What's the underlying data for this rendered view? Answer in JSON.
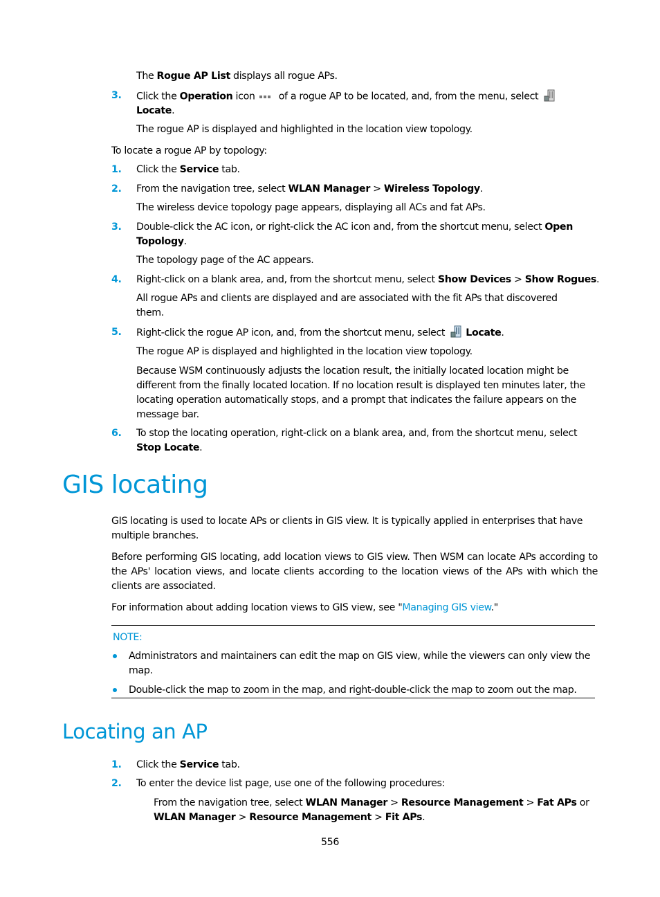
{
  "intro_line": {
    "pre": "The ",
    "bold": "Rogue AP List",
    "post": " displays all rogue APs."
  },
  "step_a3": {
    "num": "3.",
    "pre": "Click the ",
    "bold1": "Operation",
    "mid1": " icon",
    "icon": "operation-dots-icon",
    "mid2": " of a rogue AP to be located, and, from the menu, select",
    "icon2": "locate-building-icon",
    "bold2": "Locate",
    "post": ".",
    "result": "The rogue AP is displayed and highlighted in the location view topology."
  },
  "topology_intro": "To locate a rogue AP by topology:",
  "topology_steps": [
    {
      "num": "1.",
      "pre": "Click the ",
      "bold": "Service",
      "post": " tab."
    },
    {
      "num": "2.",
      "pre": "From the navigation tree, select ",
      "bold1": "WLAN Manager",
      "sep": " > ",
      "bold2": "Wireless Topology",
      "post": ".",
      "result": "The wireless device topology page appears, displaying all ACs and fat APs."
    },
    {
      "num": "3.",
      "line1_pre": "Double-click the AC icon, or right-click the AC icon and, from the shortcut menu, select ",
      "line1_bold": "Open",
      "line2_bold": "Topology",
      "line2_post": ".",
      "result": "The topology page of the AC appears."
    },
    {
      "num": "4.",
      "pre": "Right-click on a blank area, and, from the shortcut menu, select ",
      "bold1": "Show Devices",
      "sep": " > ",
      "bold2": "Show Rogues",
      "post": ".",
      "result_line1": "All rogue APs and clients are displayed and are associated with the fit APs that discovered",
      "result_line2": "them."
    },
    {
      "num": "5.",
      "pre": "Right-click the rogue AP icon, and, from the shortcut menu, select",
      "icon": "locate-building-icon",
      "bold": "Locate",
      "post": ".",
      "result": "The rogue AP is displayed and highlighted in the location view topology.",
      "note_lines": [
        "Because WSM continuously adjusts the location result, the initially located location might be",
        "different from the finally located location. If no location result is displayed ten minutes later, the",
        "locating operation automatically stops, and a prompt that indicates the failure appears on the",
        "message bar."
      ]
    },
    {
      "num": "6.",
      "line1": "To stop the locating operation, right-click on a blank area, and, from the shortcut menu, select",
      "line2_bold": "Stop Locate",
      "line2_post": "."
    }
  ],
  "gis_section": {
    "title": "GIS locating",
    "para1": "GIS locating is used to locate APs or clients in GIS view. It is typically applied in enterprises that have multiple branches.",
    "para2": "Before performing GIS locating, add location views to GIS view. Then WSM can locate APs according to the APs' location views, and locate clients according to the location views of the APs with which the clients are associated.",
    "para3_pre": "For information about adding location views to GIS view, see \"",
    "para3_link": "Managing GIS view",
    "para3_post": ".\"",
    "note_label": "NOTE:",
    "note_bullets": [
      "Administrators and maintainers can edit the map on GIS view, while the viewers can only view the map.",
      "Double-click the map to zoom in the map, and right-double-click the map to zoom out the map."
    ]
  },
  "ap_section": {
    "title": "Locating an AP",
    "steps": [
      {
        "num": "1.",
        "pre": "Click the ",
        "bold": "Service",
        "post": " tab."
      },
      {
        "num": "2.",
        "text": "To enter the device list page, use one of the following procedures:"
      }
    ],
    "sub_line1": {
      "pre": "From the navigation tree, select ",
      "b1": "WLAN Manager",
      "s1": " > ",
      "b2": "Resource Management",
      "s2": " > ",
      "b3": "Fat APs",
      "post": " or"
    },
    "sub_line2": {
      "b1": "WLAN Manager",
      "s1": " > ",
      "b2": "Resource Management",
      "s2": " > ",
      "b3": "Fit APs",
      "post": "."
    }
  },
  "page_number": "556",
  "colors": {
    "accent": "#0096d6",
    "text": "#000000"
  }
}
